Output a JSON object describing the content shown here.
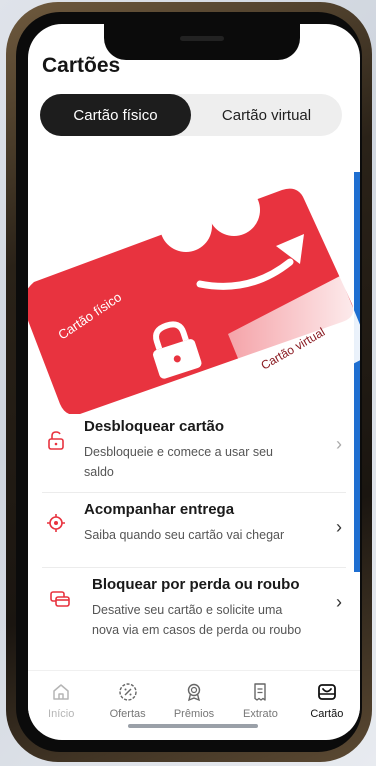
{
  "page": {
    "title": "Cartões"
  },
  "tabs": [
    {
      "label": "Cartão físico",
      "active": true
    },
    {
      "label": "Cartão virtual",
      "active": false
    }
  ],
  "card": {
    "physical_label": "Cartão físico",
    "virtual_label": "Cartão virtual",
    "color": "#e8333f"
  },
  "actions": [
    {
      "title": "Desbloquear cartão",
      "description": "Desbloqueie e comece a usar seu saldo",
      "icon": "unlock-icon"
    },
    {
      "title": "Acompanhar entrega",
      "description": "Saiba quando seu cartão vai chegar",
      "icon": "location-target-icon"
    },
    {
      "title": "Bloquear por perda ou roubo",
      "description": "Desative seu cartão e solicite uma nova via em casos de perda ou roubo",
      "icon": "block-card-icon"
    }
  ],
  "nav": [
    {
      "label": "Início",
      "icon": "home-icon",
      "state": "disabled"
    },
    {
      "label": "Ofertas",
      "icon": "percent-badge-icon",
      "state": "normal"
    },
    {
      "label": "Prêmios",
      "icon": "medal-icon",
      "state": "normal"
    },
    {
      "label": "Extrato",
      "icon": "receipt-icon",
      "state": "normal"
    },
    {
      "label": "Cartão",
      "icon": "card-wallet-icon",
      "state": "active"
    }
  ],
  "colors": {
    "accent": "#e8333f",
    "tab_active_bg": "#1d1d1d",
    "nav_active": "#111111"
  }
}
